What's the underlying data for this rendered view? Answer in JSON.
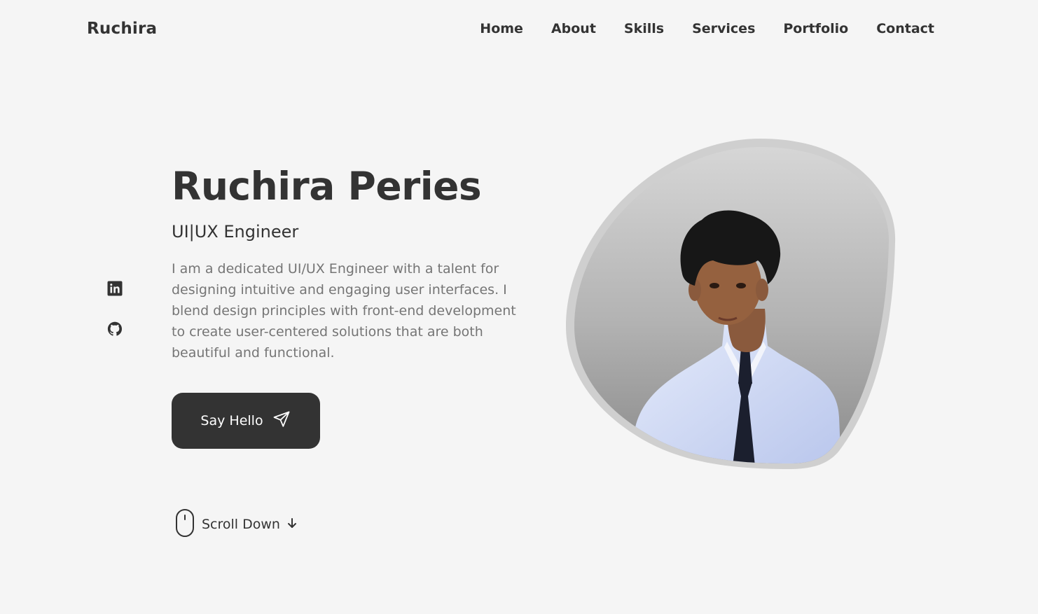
{
  "header": {
    "logo": "Ruchira",
    "nav": [
      {
        "label": "Home"
      },
      {
        "label": "About"
      },
      {
        "label": "Skills"
      },
      {
        "label": "Services"
      },
      {
        "label": "Portfolio"
      },
      {
        "label": "Contact"
      }
    ]
  },
  "social": [
    {
      "icon": "linkedin-icon"
    },
    {
      "icon": "github-icon"
    }
  ],
  "hero": {
    "title": "Ruchira Peries",
    "subtitle": "UI|UX Engineer",
    "description": "I am a dedicated UI/UX Engineer with a talent for designing intuitive and engaging user interfaces. I blend design principles with front-end development to create user-centered solutions that are both beautiful and functional.",
    "button_label": "Say Hello",
    "button_icon": "send-icon",
    "scroll_label": "Scroll Down",
    "scroll_icons": [
      "mouse-icon",
      "arrow-down-icon"
    ]
  },
  "profile_image": {
    "icon": "profile-photo"
  },
  "colors": {
    "background": "#f5f5f5",
    "text_primary": "#333333",
    "text_secondary": "#757575",
    "button_bg": "#333333",
    "button_text": "#ffffff"
  }
}
